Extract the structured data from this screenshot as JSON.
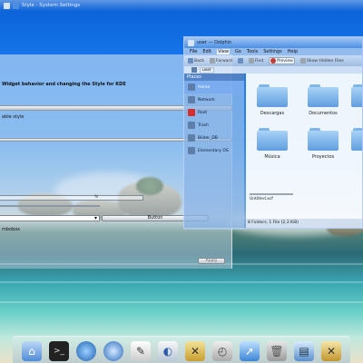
{
  "top_window": {
    "title": "Style - System Settings"
  },
  "settings": {
    "description": "Widget behavior and changing the Style for KDE",
    "style_label": "able style",
    "combobox_label": "mbobox",
    "slider_value": "%",
    "button_label": "Button",
    "apply_label": "Apply"
  },
  "dolphin": {
    "title": "user — Dolphin",
    "menu": [
      "File",
      "Edit",
      "View",
      "Go",
      "Tools",
      "Settings",
      "Help"
    ],
    "toolbar": {
      "back": "Back",
      "forward": "Forward",
      "find": "Find",
      "preview": "Preview",
      "show_hidden": "Show Hidden Files"
    },
    "location": [
      "user"
    ],
    "places_header": "Places",
    "places": [
      "Home",
      "Network",
      "Root",
      "Trash",
      "Bilder_DB",
      "Elementary OS"
    ],
    "folders": [
      "Descargas",
      "Documentos",
      "Música",
      "Proyectos"
    ],
    "file": "Untitled.xcf",
    "status": "8 Folders, 1 File (2,3 KiB)"
  },
  "dock": {
    "items": [
      "home-folder",
      "terminal",
      "web-browser",
      "web-browser-2",
      "text-editor",
      "paint-tool",
      "system-tools",
      "calendar",
      "pointer-tool",
      "trash",
      "image-viewer",
      "tools"
    ]
  }
}
